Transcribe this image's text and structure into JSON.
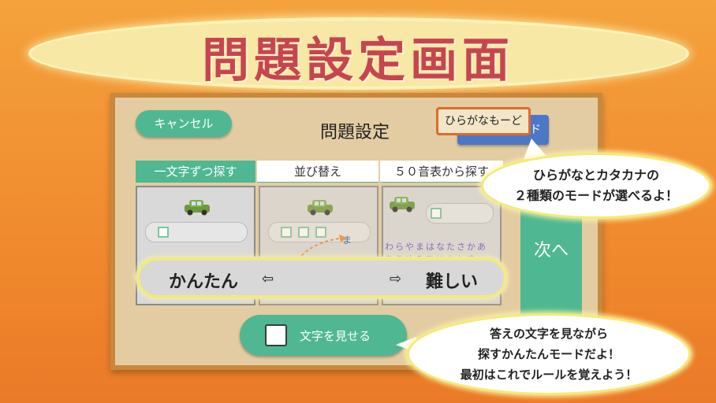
{
  "title": "問題設定画面",
  "header": {
    "cancel_label": "キャンセル",
    "settings_title": "問題設定",
    "mode_front_label": "ひらがなもーど",
    "mode_back_label": "ド"
  },
  "tabs": [
    {
      "label": "一文字ずつ探す",
      "active": true
    },
    {
      "label": "並び替え",
      "active": false
    },
    {
      "label": "５０音表から探す",
      "active": false
    }
  ],
  "panel_3_kana_rows": [
    "わらやまはなたさかあ",
    "をりゆみひにちしきい"
  ],
  "panel_2_letter": "ま",
  "next_label": "次へ",
  "difficulty": {
    "easy_label": "かんたん",
    "hard_label": "難しい",
    "left_arrow": "⇦",
    "right_arrow": "⇨"
  },
  "show_letters": {
    "label": "文字を見せる",
    "checked": false
  },
  "bubbles": {
    "mode_note": [
      "ひらがなとカタカナの",
      "２種類のモードが選べるよ！"
    ],
    "easy_note": [
      "答えの文字を見ながら",
      "探すかんたんモードだよ！",
      "最初はこれでルールを覚えよう！"
    ]
  },
  "colors": {
    "accent": "#4fb892",
    "title": "#c6454f",
    "background": "#f08a2e",
    "mode_button": "#4c77c6"
  }
}
